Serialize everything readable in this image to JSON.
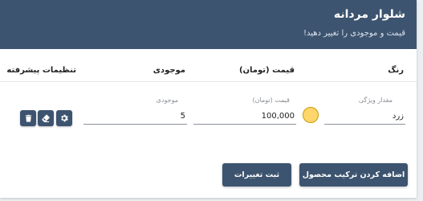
{
  "header": {
    "title": "شلوار مردانه",
    "subtitle": "قیمت و موجودی را تغییر دهید!"
  },
  "table": {
    "columns": {
      "color": "رنگ",
      "price": "قیمت (تومان)",
      "stock": "موجودی",
      "advanced": "تنظیمات پیشرفته"
    }
  },
  "row": {
    "feature_label": "مقدار ویژگی",
    "feature_value": "زرد",
    "swatch_color": "#ffd66b",
    "price_label": "قیمت (تومان)",
    "price_value": "100,000",
    "stock_label": "موجودی",
    "stock_value": "5",
    "action_icons": [
      "gear-icon",
      "eraser-icon",
      "trash-icon"
    ]
  },
  "buttons": {
    "add_combination": "اضافه کردن ترکیب محصول",
    "save_changes": "ثبت تغییرات"
  },
  "colors": {
    "primary": "#3d5470",
    "swatch": "#ffd66b"
  }
}
